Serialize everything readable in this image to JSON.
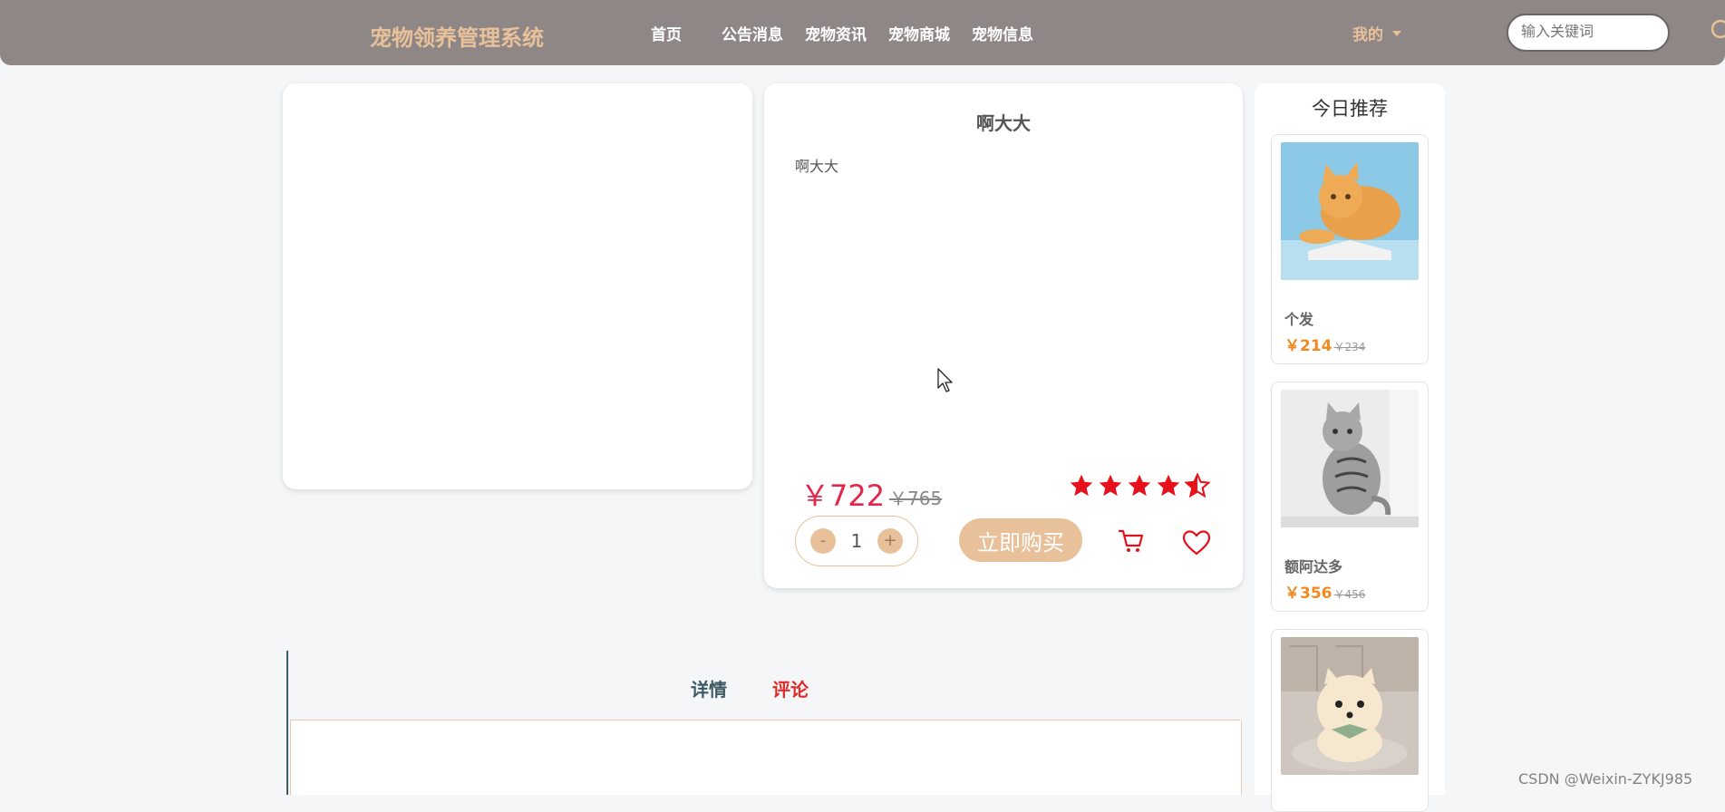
{
  "header": {
    "brand": "宠物领养管理系统",
    "nav": [
      "首页",
      "公告消息",
      "宠物资讯",
      "宠物商城",
      "宠物信息"
    ],
    "user_menu": "我的",
    "search_placeholder": "输入关键词"
  },
  "product": {
    "title": "啊大大",
    "subtitle": "啊大大",
    "price": "￥722",
    "original_price": "￥765",
    "rating": 4.5,
    "quantity": "1",
    "decrement": "-",
    "increment": "+",
    "buy_label": "立即购买"
  },
  "recommend": {
    "title": "今日推荐",
    "items": [
      {
        "name": "个发",
        "price": "￥214",
        "original_price": "￥234"
      },
      {
        "name": "额阿达多",
        "price": "￥356",
        "original_price": "￥456"
      },
      {
        "name": "",
        "price": "",
        "original_price": ""
      }
    ]
  },
  "tabs": {
    "details": "详情",
    "comments": "评论"
  },
  "watermark": "CSDN @Weixin-ZYKJ985",
  "colors": {
    "header_bg": "#8f8786",
    "accent": "#e8c19a",
    "price": "#e3264a",
    "star": "#e8101a",
    "active_tab": "#e02a2a"
  }
}
